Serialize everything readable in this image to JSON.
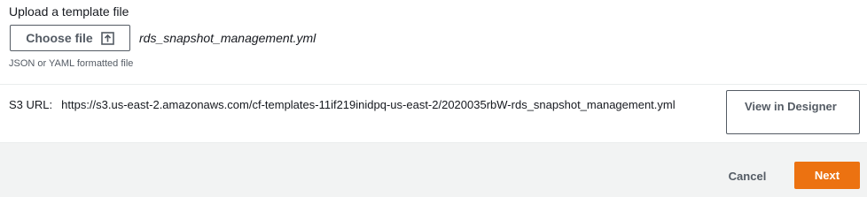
{
  "upload": {
    "label": "Upload a template file",
    "choose_file_label": "Choose file",
    "choose_file_icon": "upload-icon",
    "file_name": "rds_snapshot_management.yml",
    "format_hint": "JSON or YAML formatted file"
  },
  "s3": {
    "label": "S3 URL:",
    "url": "https://s3.us-east-2.amazonaws.com/cf-templates-11if219inidpq-us-east-2/2020035rbW-rds_snapshot_management.yml",
    "view_designer_label": "View in Designer"
  },
  "footer": {
    "cancel_label": "Cancel",
    "next_label": "Next"
  },
  "colors": {
    "primary_button": "#ec7211",
    "secondary_text": "#545b64",
    "footer_background": "#f2f3f3"
  }
}
